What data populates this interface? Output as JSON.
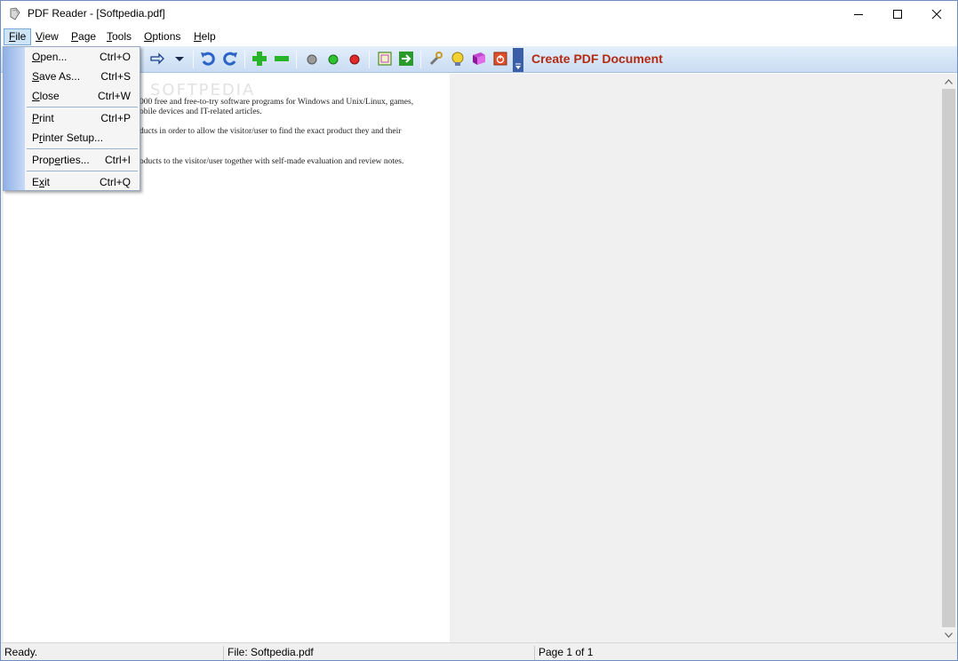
{
  "window": {
    "title": "PDF Reader - [Softpedia.pdf]"
  },
  "menubar": {
    "items": [
      {
        "label_ul": "F",
        "label_rest": "ile",
        "active": true
      },
      {
        "label_ul": "V",
        "label_rest": "iew"
      },
      {
        "label_ul": "P",
        "label_rest": "age"
      },
      {
        "label_ul": "T",
        "label_rest": "ools"
      },
      {
        "label_ul": "O",
        "label_rest": "ptions"
      },
      {
        "label_ul": "H",
        "label_rest": "elp"
      }
    ]
  },
  "toolbar": {
    "create_label": "Create PDF Document",
    "icons": [
      "forward-arrow-icon",
      "dropdown-icon",
      "undo-icon",
      "redo-icon",
      "zoom-in-icon",
      "zoom-out-icon",
      "gray-circle-icon",
      "green-circle-icon",
      "red-circle-icon",
      "page-icon",
      "go-icon",
      "tools-icon",
      "bulb-icon",
      "book-icon",
      "power-icon"
    ]
  },
  "file_menu": {
    "items": [
      {
        "ul": "O",
        "rest": "pen...",
        "shortcut": "Ctrl+O"
      },
      {
        "ul": "S",
        "rest": "ave As...",
        "shortcut": "Ctrl+S"
      },
      {
        "ul": "C",
        "rest": "lose",
        "shortcut": "Ctrl+W"
      },
      {
        "ul": "P",
        "rest": "rint",
        "shortcut": "Ctrl+P"
      },
      {
        "pre": "P",
        "ul": "r",
        "rest": "inter Setup...",
        "shortcut": ""
      },
      {
        "pre": "Prop",
        "ul": "e",
        "rest": "rties...",
        "shortcut": "Ctrl+I"
      },
      {
        "pre": "E",
        "ul": "x",
        "rest": "it",
        "shortcut": "Ctrl+Q"
      }
    ]
  },
  "document": {
    "watermark": "SOFTPEDIA",
    "lines": [
      "000 free and free-to-try software programs for Windows and Unix/Linux, games,",
      "obile devices and IT-related articles.",
      "ducts in order to allow the visitor/user to find the exact product they and their",
      "oducts to the visitor/user together with self-made evaluation and review notes."
    ]
  },
  "statusbar": {
    "status": "Ready.",
    "file": "File: Softpedia.pdf",
    "page": "Page 1 of 1"
  },
  "colors": {
    "accent": "#b22a12",
    "toolbar_top": "#e4effb",
    "toolbar_bottom": "#c9dcf3",
    "menu_strip": "#8fb0e6"
  }
}
